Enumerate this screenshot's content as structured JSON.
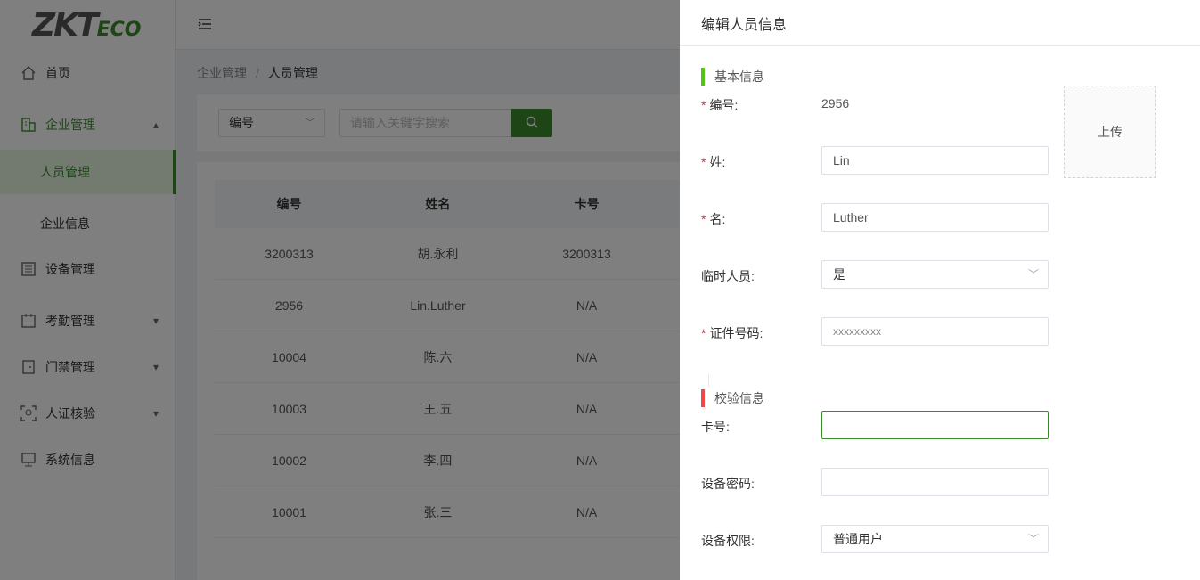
{
  "app": {
    "logo_main": "ZKT",
    "logo_sub": "ECO"
  },
  "sidebar": {
    "items": [
      {
        "label": "首页",
        "icon": "home-icon"
      },
      {
        "label": "企业管理",
        "icon": "building-icon",
        "expanded": true
      },
      {
        "label": "设备管理",
        "icon": "device-list-icon"
      },
      {
        "label": "考勤管理",
        "icon": "calendar-icon"
      },
      {
        "label": "门禁管理",
        "icon": "door-icon"
      },
      {
        "label": "人证核验",
        "icon": "face-scan-icon"
      },
      {
        "label": "系统信息",
        "icon": "monitor-icon"
      }
    ],
    "submenu": [
      {
        "label": "人员管理",
        "selected": true
      },
      {
        "label": "企业信息",
        "selected": false
      }
    ]
  },
  "breadcrumb": {
    "parent": "企业管理",
    "separator": "/",
    "current": "人员管理"
  },
  "filter": {
    "field_select": "编号",
    "search_placeholder": "请输入关键字搜索"
  },
  "table": {
    "columns": [
      "编号",
      "姓名",
      "卡号"
    ],
    "rows": [
      [
        "3200313",
        "胡.永利",
        "3200313"
      ],
      [
        "2956",
        "Lin.Luther",
        "N/A"
      ],
      [
        "10004",
        "陈.六",
        "N/A"
      ],
      [
        "10003",
        "王.五",
        "N/A"
      ],
      [
        "10002",
        "李.四",
        "N/A"
      ],
      [
        "10001",
        "张.三",
        "N/A"
      ]
    ]
  },
  "drawer": {
    "title": "编辑人员信息",
    "basic_section": "基本信息",
    "verify_section": "校验信息",
    "upload_label": "上传",
    "required_mark": "*",
    "fields": {
      "id_label": "编号:",
      "id_value": "2956",
      "surname_label": "姓:",
      "surname_value": "Lin",
      "given_label": "名:",
      "given_value": "Luther",
      "temp_label": "临时人员:",
      "temp_value": "是",
      "cert_label": "证件号码:",
      "cert_value": "xxxxxxxxx",
      "card_label": "卡号:",
      "card_value": "",
      "pwd_label": "设备密码:",
      "pwd_value": "",
      "perm_label": "设备权限:",
      "perm_value": "普通用户"
    }
  },
  "colors": {
    "brand_green": "#3a8a2c",
    "required_red": "#f5222d",
    "verify_bar": "#f04848",
    "basic_bar": "#52c41a"
  }
}
